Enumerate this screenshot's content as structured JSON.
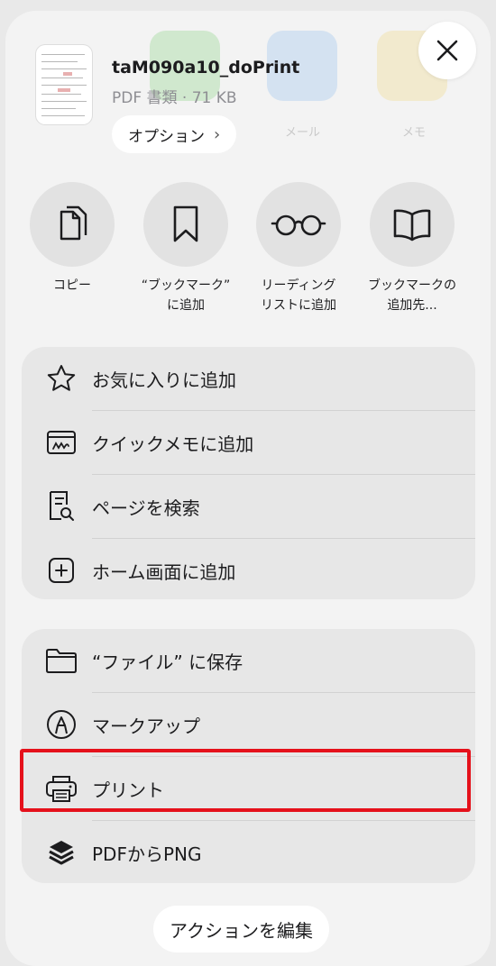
{
  "header": {
    "file_name": "taM090a10_doPrint",
    "file_info": "PDF 書類 · 71 KB",
    "options_label": "オプション",
    "options_chevron": "›"
  },
  "quick_actions": [
    {
      "label_line1": "コピー",
      "label_line2": "",
      "icon": "copy-icon"
    },
    {
      "label_line1": "“ブックマーク”",
      "label_line2": "に追加",
      "icon": "bookmark-icon"
    },
    {
      "label_line1": "リーディング",
      "label_line2": "リストに追加",
      "icon": "glasses-icon"
    },
    {
      "label_line1": "ブックマークの",
      "label_line2": "追加先...",
      "icon": "book-icon"
    }
  ],
  "menu_group_1": [
    {
      "label": "お気に入りに追加",
      "icon": "star-icon"
    },
    {
      "label": "クイックメモに追加",
      "icon": "quick-note-icon"
    },
    {
      "label": "ページを検索",
      "icon": "find-on-page-icon"
    },
    {
      "label": "ホーム画面に追加",
      "icon": "add-square-icon"
    }
  ],
  "menu_group_2": [
    {
      "label": "“ファイル” に保存",
      "icon": "folder-icon"
    },
    {
      "label": "マークアップ",
      "icon": "markup-pen-icon"
    },
    {
      "label": "プリント",
      "icon": "printer-icon"
    },
    {
      "label": "PDFからPNG",
      "icon": "layers-icon"
    }
  ],
  "background_hints": {
    "mail": "メール",
    "memo": "メモ"
  },
  "edit_actions_label": "アクションを編集",
  "highlight_color": "#e5111b"
}
